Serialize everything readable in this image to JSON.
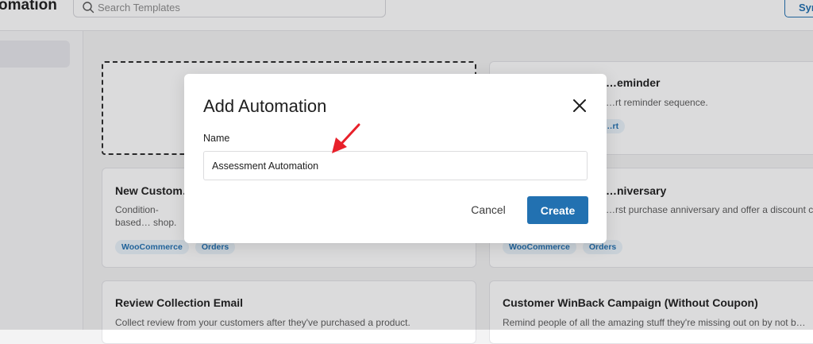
{
  "header": {
    "app_title": "omation",
    "search_placeholder": "Search Templates",
    "sync_label": "Syn"
  },
  "cards": [
    {
      "title": "…eminder",
      "description": "…rt reminder sequence.",
      "tags": [
        "…rt"
      ]
    },
    {
      "title": "New Custom…",
      "description": "Condition-based… shop.",
      "tags": [
        "WooCommerce",
        "Orders"
      ]
    },
    {
      "title": "…niversary",
      "description": "…rst purchase anniversary and offer a discount c…",
      "tags": [
        "WooCommerce",
        "Orders"
      ]
    },
    {
      "title": "Review Collection Email",
      "description": "Collect review from your customers after they've purchased a product.",
      "tags": []
    },
    {
      "title": "Customer WinBack Campaign (Without Coupon)",
      "description": "Remind people of all the amazing stuff they're missing out on by not b…",
      "tags": []
    }
  ],
  "modal": {
    "title": "Add Automation",
    "name_label": "Name",
    "name_value": "Assessment Automation",
    "cancel_label": "Cancel",
    "create_label": "Create"
  },
  "colors": {
    "accent": "#2271b1",
    "annotation_arrow": "#e8202a"
  }
}
